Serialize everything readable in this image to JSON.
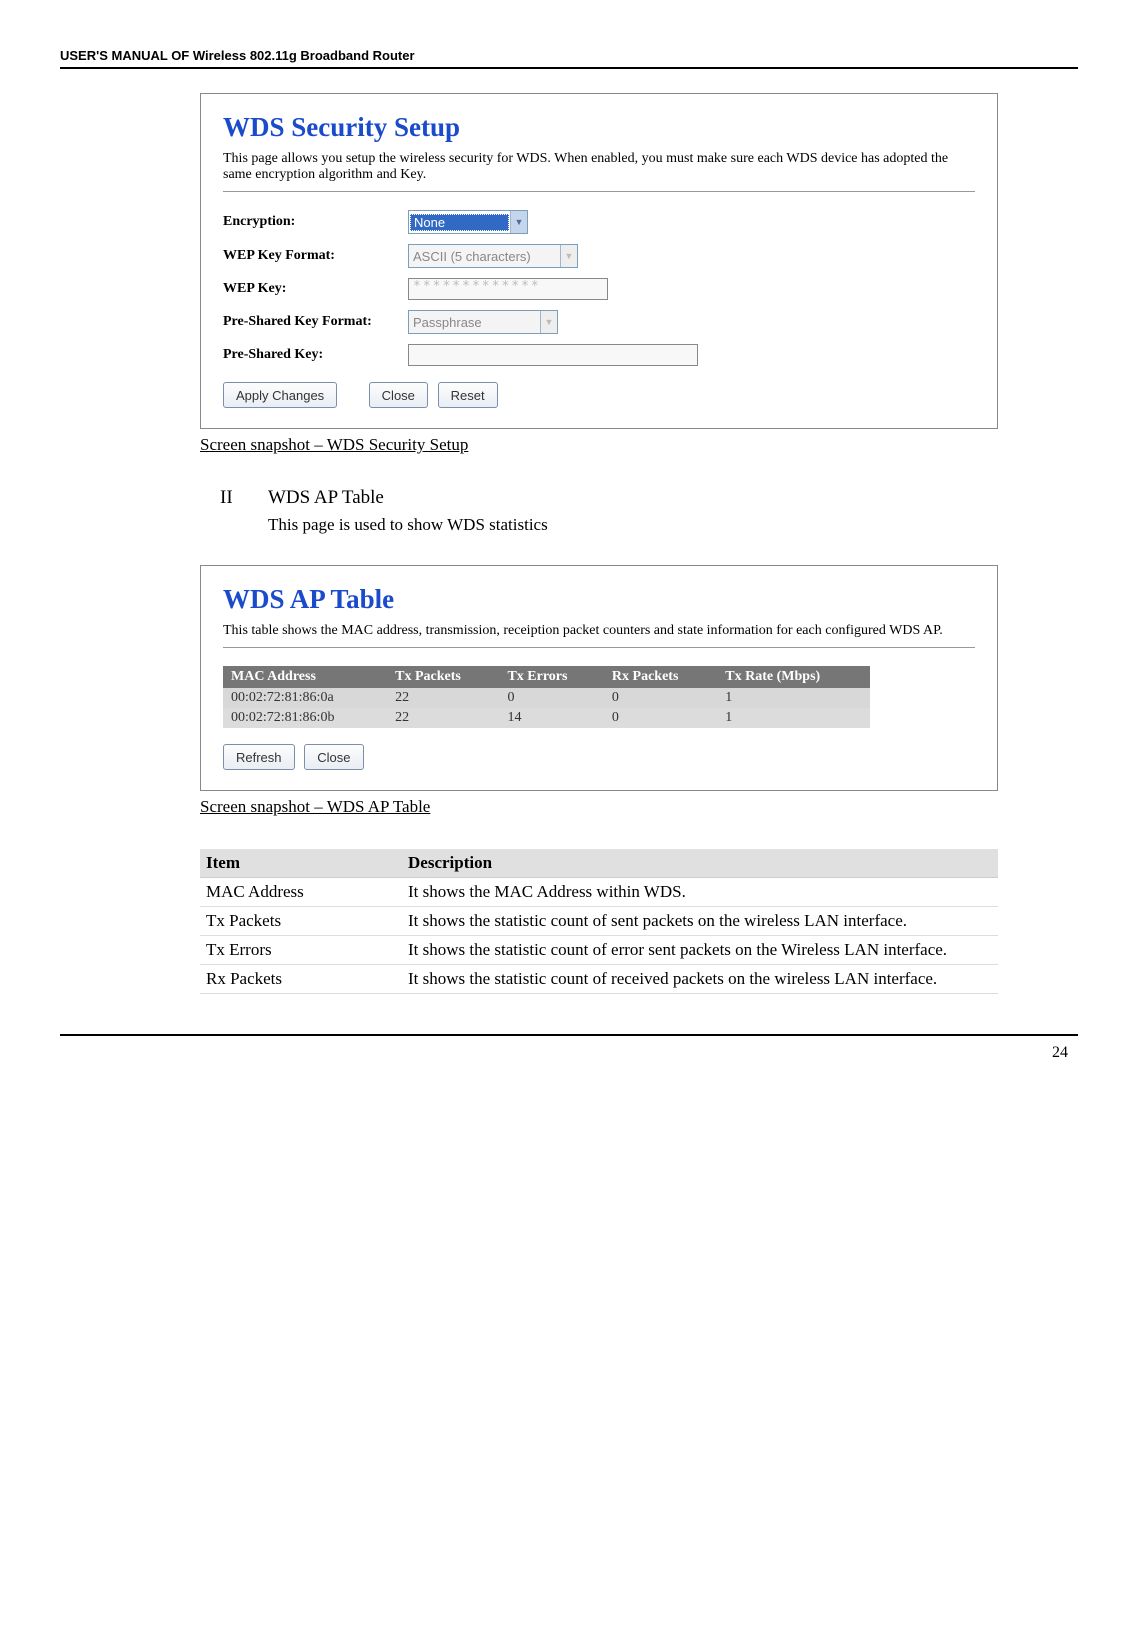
{
  "header": {
    "title": "USER'S MANUAL OF Wireless 802.11g Broadband Router"
  },
  "panel1": {
    "title": "WDS Security Setup",
    "subtitle": "This page allows you setup the wireless security for WDS. When enabled, you must make sure each WDS device has adopted the same encryption algorithm and Key.",
    "rows": {
      "encryption_label": "Encryption:",
      "encryption_value": "None",
      "wepfmt_label": "WEP Key Format:",
      "wepfmt_value": "ASCII (5 characters)",
      "wepkey_label": "WEP Key:",
      "wepkey_value": "*************",
      "pskfmt_label": "Pre-Shared Key Format:",
      "pskfmt_value": "Passphrase",
      "psk_label": "Pre-Shared Key:",
      "psk_value": ""
    },
    "buttons": {
      "apply": "Apply Changes",
      "close": "Close",
      "reset": "Reset"
    }
  },
  "caption1": "Screen snapshot – WDS Security Setup",
  "section2": {
    "numeral": "II",
    "title": "WDS AP Table",
    "body": "This page is used to show WDS statistics"
  },
  "panel2": {
    "title": "WDS AP Table",
    "subtitle": "This table shows the MAC address, transmission, receiption packet counters and state information for each configured WDS AP.",
    "table": {
      "headers": [
        "MAC Address",
        "Tx Packets",
        "Tx Errors",
        "Rx Packets",
        "Tx Rate (Mbps)"
      ],
      "rows": [
        [
          "00:02:72:81:86:0a",
          "22",
          "0",
          "0",
          "1"
        ],
        [
          "00:02:72:81:86:0b",
          "22",
          "14",
          "0",
          "1"
        ]
      ]
    },
    "buttons": {
      "refresh": "Refresh",
      "close": "Close"
    }
  },
  "caption2": "Screen snapshot – WDS AP Table",
  "desc_table": {
    "headers": [
      "Item",
      "Description"
    ],
    "rows": [
      [
        "MAC Address",
        "It shows the MAC Address within WDS."
      ],
      [
        "Tx Packets",
        "It shows the statistic count of sent packets on the wireless LAN interface."
      ],
      [
        "Tx Errors",
        "It shows the statistic count of error sent packets on the Wireless LAN interface."
      ],
      [
        "Rx Packets",
        "It shows the statistic count of received packets on the wireless LAN interface."
      ]
    ]
  },
  "page_number": "24"
}
